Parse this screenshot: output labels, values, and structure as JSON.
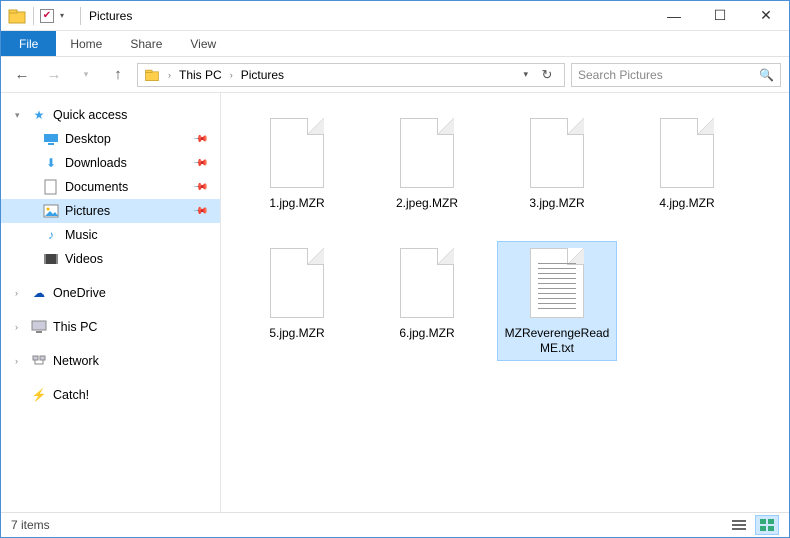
{
  "titlebar": {
    "title": "Pictures"
  },
  "window_buttons": {
    "min": "—",
    "max": "☐",
    "close": "✕"
  },
  "ribbon": {
    "file": "File",
    "tabs": [
      "Home",
      "Share",
      "View"
    ]
  },
  "breadcrumbs": [
    "This PC",
    "Pictures"
  ],
  "search": {
    "placeholder": "Search Pictures"
  },
  "sidebar": {
    "quick_access": "Quick access",
    "items": [
      {
        "label": "Desktop",
        "pinned": true
      },
      {
        "label": "Downloads",
        "pinned": true
      },
      {
        "label": "Documents",
        "pinned": true
      },
      {
        "label": "Pictures",
        "pinned": true,
        "selected": true
      },
      {
        "label": "Music",
        "pinned": false
      },
      {
        "label": "Videos",
        "pinned": false
      }
    ],
    "onedrive": "OneDrive",
    "thispc": "This PC",
    "network": "Network",
    "catch": "Catch!"
  },
  "files": [
    {
      "name": "1.jpg.MZR",
      "type": "blank",
      "selected": false
    },
    {
      "name": "2.jpeg.MZR",
      "type": "blank",
      "selected": false
    },
    {
      "name": "3.jpg.MZR",
      "type": "blank",
      "selected": false
    },
    {
      "name": "4.jpg.MZR",
      "type": "blank",
      "selected": false
    },
    {
      "name": "5.jpg.MZR",
      "type": "blank",
      "selected": false
    },
    {
      "name": "6.jpg.MZR",
      "type": "blank",
      "selected": false
    },
    {
      "name": "MZReverengeReadME.txt",
      "type": "text",
      "selected": true
    }
  ],
  "status": {
    "count": "7 items"
  },
  "colors": {
    "accent": "#1979ca",
    "selection": "#cde8ff"
  }
}
